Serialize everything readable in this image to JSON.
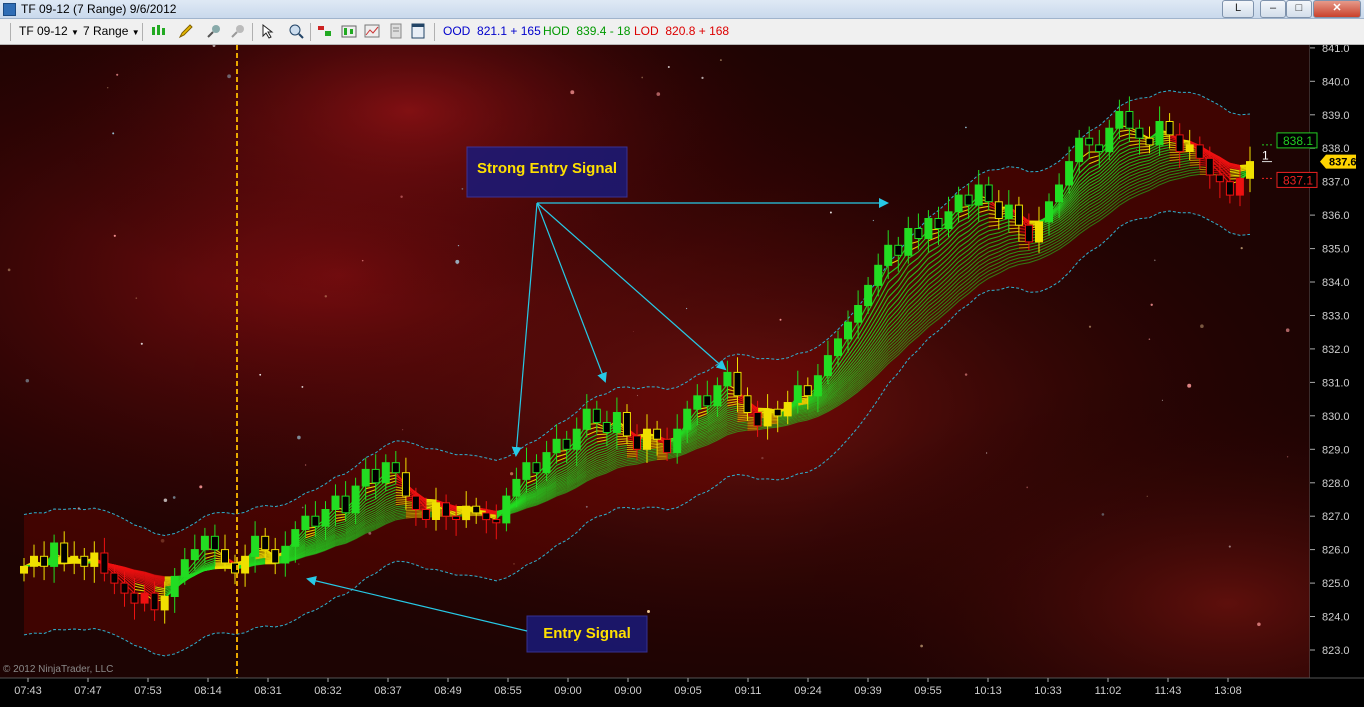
{
  "window": {
    "title": "TF 09-12 (7 Range)  9/6/2012",
    "lang_button": "L",
    "minimize_glyph": "–",
    "maximize_glyph": "□",
    "close_glyph": "✕"
  },
  "toolbar": {
    "instrument": "TF 09-12",
    "period": "7 Range",
    "icons": [
      "bar-style-icon",
      "drawing-pencil-icon",
      "pin-icon",
      "crosshair-icon",
      "pointer-icon",
      "zoom-icon",
      "data-box-icon",
      "candles-icon",
      "chart-image-icon",
      "properties-icon",
      "panel-icon"
    ],
    "ood_label": "OOD",
    "ood_value": "821.1 + 165",
    "hod_label": "HOD",
    "hod_value": "839.4 - 18",
    "lod_label": "LOD",
    "lod_value": "820.8 + 168",
    "colors": {
      "ood": "#0000cc",
      "hod": "#009900",
      "lod": "#dd0000"
    }
  },
  "chart_data": {
    "type": "candlestick",
    "title": "",
    "copyright": "© 2012 NinjaTrader, LLC",
    "x_tick_labels": [
      "07:43",
      "07:47",
      "07:53",
      "08:14",
      "08:31",
      "08:32",
      "08:37",
      "08:49",
      "08:55",
      "09:00",
      "09:00",
      "09:05",
      "09:11",
      "09:24",
      "09:39",
      "09:55",
      "10:13",
      "10:33",
      "11:02",
      "11:43",
      "13:08"
    ],
    "ylim": [
      822.5,
      841.2
    ],
    "y_ticks": [
      823,
      824,
      825,
      826,
      827,
      828,
      829,
      830,
      831,
      832,
      833,
      834,
      835,
      836,
      837,
      838,
      839,
      840,
      841
    ],
    "price_tags": [
      {
        "value": 838.1,
        "text": "838.1",
        "color": "#22cc22"
      },
      {
        "value": 837.6,
        "text": "837.6",
        "color": "#ffd400"
      },
      {
        "value": 837.1,
        "text": "837.1",
        "color": "#ee2222"
      }
    ],
    "position_marker": "1",
    "session_break_index": 11,
    "colors": {
      "up": "#22dd22",
      "neutral": "#f0e000",
      "down": "#ee1111",
      "band": "#2fb8d8",
      "session_line": "#e8a800",
      "annotation": "#27c9e6",
      "label_bg": "#1a1a7a",
      "label_text": "#ffe000"
    },
    "closes": [
      825.5,
      825.8,
      825.5,
      826.2,
      825.6,
      825.8,
      825.5,
      825.9,
      825.3,
      825.0,
      824.7,
      824.4,
      824.7,
      824.2,
      824.6,
      825.2,
      825.7,
      826.0,
      826.4,
      826.0,
      825.6,
      825.3,
      825.8,
      826.4,
      826.0,
      825.6,
      826.1,
      826.6,
      827.0,
      826.7,
      827.2,
      827.6,
      827.1,
      827.9,
      828.4,
      828.0,
      828.6,
      828.3,
      827.6,
      827.2,
      826.9,
      827.4,
      827.0,
      826.9,
      827.3,
      827.1,
      826.9,
      826.8,
      827.6,
      828.1,
      828.6,
      828.3,
      828.9,
      829.3,
      829.0,
      829.6,
      830.2,
      829.8,
      829.5,
      830.1,
      829.4,
      829.0,
      829.6,
      829.3,
      828.9,
      829.6,
      830.2,
      830.6,
      830.3,
      830.9,
      831.3,
      830.6,
      830.1,
      829.7,
      830.2,
      830.0,
      830.4,
      830.9,
      830.6,
      831.2,
      831.8,
      832.3,
      832.8,
      833.3,
      833.9,
      834.5,
      835.1,
      834.8,
      835.6,
      835.3,
      835.9,
      835.6,
      836.1,
      836.6,
      836.3,
      836.9,
      836.4,
      835.9,
      836.3,
      835.7,
      835.2,
      835.8,
      836.4,
      836.9,
      837.6,
      838.3,
      838.1,
      837.9,
      838.6,
      839.1,
      838.6,
      838.3,
      838.1,
      838.8,
      838.4,
      837.9,
      838.1,
      837.7,
      837.2,
      837.0,
      836.6,
      837.1,
      837.6
    ],
    "annotations": [
      {
        "text": "Strong Entry Signal"
      },
      {
        "text": "Entry Signal"
      }
    ]
  }
}
